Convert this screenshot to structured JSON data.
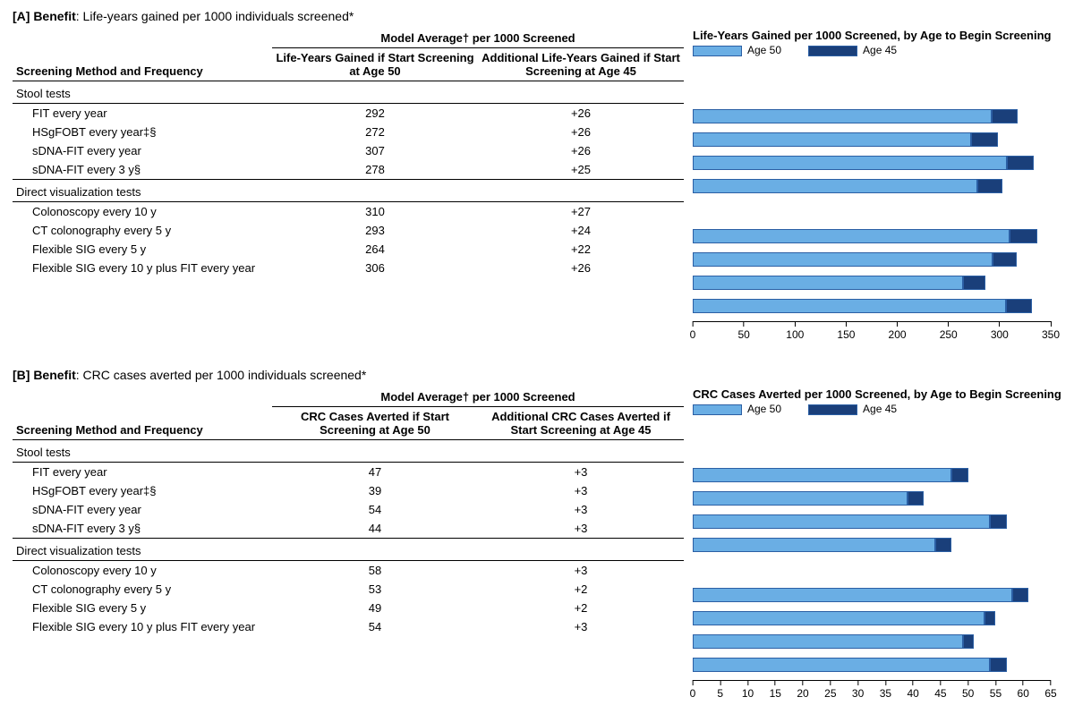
{
  "panelA": {
    "title_prefix": "[A] Benefit",
    "title_rest": ": Life-years gained per 1000 individuals screened*",
    "super_header": "Model Average† per 1000 Screened",
    "col_method": "Screening Method and Frequency",
    "col1": "Life-Years Gained if Start Screening at Age 50",
    "col2": "Additional Life-Years Gained if Start Screening at Age 45",
    "chart_title": "Life-Years Gained per 1000 Screened, by Age to Begin Screening",
    "legend50": "Age 50",
    "legend45": "Age 45",
    "group1": "Stool tests",
    "group2": "Direct visualization tests",
    "rows": [
      {
        "label": "FIT every year",
        "v50": "292",
        "v45": "+26"
      },
      {
        "label": "HSgFOBT every year‡§",
        "v50": "272",
        "v45": "+26"
      },
      {
        "label": "sDNA-FIT every year",
        "v50": "307",
        "v45": "+26"
      },
      {
        "label": "sDNA-FIT every 3 y§",
        "v50": "278",
        "v45": "+25"
      },
      {
        "label": "Colonoscopy every 10 y",
        "v50": "310",
        "v45": "+27"
      },
      {
        "label": "CT colonography every 5 y",
        "v50": "293",
        "v45": "+24"
      },
      {
        "label": "Flexible SIG every 5 y",
        "v50": "264",
        "v45": "+22"
      },
      {
        "label": "Flexible SIG every 10 y plus FIT every year",
        "v50": "306",
        "v45": "+26"
      }
    ],
    "axis_ticks": [
      "0",
      "50",
      "100",
      "150",
      "200",
      "250",
      "300",
      "350"
    ]
  },
  "panelB": {
    "title_prefix": "[B] Benefit",
    "title_rest": ": CRC cases averted per 1000 individuals screened*",
    "super_header": "Model Average† per 1000 Screened",
    "col_method": "Screening Method and Frequency",
    "col1": "CRC Cases Averted if Start Screening at Age 50",
    "col2": "Additional CRC Cases Averted if Start Screening at Age 45",
    "chart_title": "CRC Cases Averted per 1000 Screened, by Age to Begin Screening",
    "legend50": "Age 50",
    "legend45": "Age 45",
    "group1": "Stool tests",
    "group2": "Direct visualization tests",
    "rows": [
      {
        "label": "FIT every year",
        "v50": "47",
        "v45": "+3"
      },
      {
        "label": "HSgFOBT every year‡§",
        "v50": "39",
        "v45": "+3"
      },
      {
        "label": "sDNA-FIT every year",
        "v50": "54",
        "v45": "+3"
      },
      {
        "label": "sDNA-FIT every 3 y§",
        "v50": "44",
        "v45": "+3"
      },
      {
        "label": "Colonoscopy every 10 y",
        "v50": "58",
        "v45": "+3"
      },
      {
        "label": "CT colonography every 5 y",
        "v50": "53",
        "v45": "+2"
      },
      {
        "label": "Flexible SIG every 5 y",
        "v50": "49",
        "v45": "+2"
      },
      {
        "label": "Flexible SIG every 10 y plus FIT every year",
        "v50": "54",
        "v45": "+3"
      }
    ],
    "axis_ticks": [
      "0",
      "5",
      "10",
      "15",
      "20",
      "25",
      "30",
      "35",
      "40",
      "45",
      "50",
      "55",
      "60",
      "65"
    ]
  },
  "chart_data": [
    {
      "type": "bar",
      "orientation": "horizontal",
      "stacked": true,
      "title": "Life-Years Gained per 1000 Screened, by Age to Begin Screening",
      "categories": [
        "FIT every year",
        "HSgFOBT every year",
        "sDNA-FIT every year",
        "sDNA-FIT every 3 y",
        "Colonoscopy every 10 y",
        "CT colonography every 5 y",
        "Flexible SIG every 5 y",
        "Flexible SIG every 10 y plus FIT every year"
      ],
      "series": [
        {
          "name": "Age 50",
          "values": [
            292,
            272,
            307,
            278,
            310,
            293,
            264,
            306
          ],
          "color": "#6aaee4"
        },
        {
          "name": "Age 45 (additional)",
          "values": [
            26,
            26,
            26,
            25,
            27,
            24,
            22,
            26
          ],
          "color": "#1a3f7a"
        }
      ],
      "xlim": [
        0,
        350
      ],
      "xticks": [
        0,
        50,
        100,
        150,
        200,
        250,
        300,
        350
      ]
    },
    {
      "type": "bar",
      "orientation": "horizontal",
      "stacked": true,
      "title": "CRC Cases Averted per 1000 Screened, by Age to Begin Screening",
      "categories": [
        "FIT every year",
        "HSgFOBT every year",
        "sDNA-FIT every year",
        "sDNA-FIT every 3 y",
        "Colonoscopy every 10 y",
        "CT colonography every 5 y",
        "Flexible SIG every 5 y",
        "Flexible SIG every 10 y plus FIT every year"
      ],
      "series": [
        {
          "name": "Age 50",
          "values": [
            47,
            39,
            54,
            44,
            58,
            53,
            49,
            54
          ],
          "color": "#6aaee4"
        },
        {
          "name": "Age 45 (additional)",
          "values": [
            3,
            3,
            3,
            3,
            3,
            2,
            2,
            3
          ],
          "color": "#1a3f7a"
        }
      ],
      "xlim": [
        0,
        65
      ],
      "xticks": [
        0,
        5,
        10,
        15,
        20,
        25,
        30,
        35,
        40,
        45,
        50,
        55,
        60,
        65
      ]
    }
  ]
}
